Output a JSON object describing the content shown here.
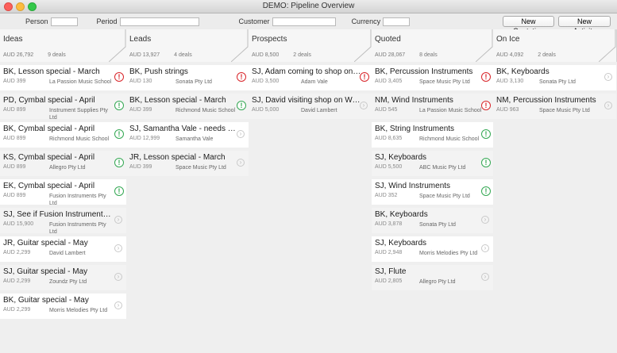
{
  "window": {
    "title": "DEMO: Pipeline Overview"
  },
  "toolbar": {
    "person_label": "Person",
    "person_value": "",
    "period_label": "Period",
    "period_value": "",
    "customer_label": "Customer",
    "customer_value": "",
    "currency_label": "Currency",
    "currency_value": "",
    "new_quotation": "New Quotation",
    "new_activity": "New Activity"
  },
  "columns": [
    {
      "title": "Ideas",
      "amount": "AUD 26,792",
      "deals": "9 deals",
      "cards": [
        {
          "title": "BK, Lesson special - March",
          "amount": "AUD 399",
          "customer": "La Passion Music School",
          "status": "red"
        },
        {
          "title": "PD, Cymbal special - April",
          "amount": "AUD 899",
          "customer": "Instrument Supplies Pty Ltd",
          "status": "green"
        },
        {
          "title": "BK, Cymbal special - April",
          "amount": "AUD 899",
          "customer": "Richmond Music School",
          "status": "green"
        },
        {
          "title": "KS, Cymbal special - April",
          "amount": "AUD 899",
          "customer": "Allegro Pty Ltd",
          "status": "green"
        },
        {
          "title": "EK, Cymbal special - April",
          "amount": "AUD 899",
          "customer": "Fusion Instruments Pty Ltd",
          "status": "green"
        },
        {
          "title": "SJ, See if Fusion Instruments wa...",
          "amount": "AUD 15,900",
          "customer": "Fusion Instruments Pty Ltd",
          "status": "arrow"
        },
        {
          "title": "JR, Guitar special - May",
          "amount": "AUD 2,299",
          "customer": "David Lambert",
          "status": "arrow"
        },
        {
          "title": "SJ, Guitar special - May",
          "amount": "AUD 2,299",
          "customer": "Zoundz Pty Ltd",
          "status": "arrow"
        },
        {
          "title": "BK, Guitar special - May",
          "amount": "AUD 2,299",
          "customer": "Morris Melodies Pty Ltd",
          "status": "arrow"
        }
      ]
    },
    {
      "title": "Leads",
      "amount": "AUD 13,927",
      "deals": "4 deals",
      "cards": [
        {
          "title": "BK, Push strings",
          "amount": "AUD 130",
          "customer": "Sonata Pty Ltd",
          "status": "red"
        },
        {
          "title": "BK, Lesson special - March",
          "amount": "AUD 399",
          "customer": "Richmond Music School",
          "status": "green"
        },
        {
          "title": "SJ, Samantha Vale - needs upgr...",
          "amount": "AUD 12,999",
          "customer": "Samantha Vale",
          "status": "arrow"
        },
        {
          "title": "JR, Lesson special - March",
          "amount": "AUD 399",
          "customer": "Space Music Pty Ltd",
          "status": "arrow"
        }
      ]
    },
    {
      "title": "Prospects",
      "amount": "AUD 8,500",
      "deals": "2 deals",
      "cards": [
        {
          "title": "SJ, Adam coming to shop on W...",
          "amount": "AUD 3,500",
          "customer": "Adam Vale",
          "status": "red"
        },
        {
          "title": "SJ, David visiting shop on Wedn...",
          "amount": "AUD 5,000",
          "customer": "David Lambert",
          "status": "arrow"
        }
      ]
    },
    {
      "title": "Quoted",
      "amount": "AUD 28,067",
      "deals": "8 deals",
      "cards": [
        {
          "title": "BK, Percussion Instruments",
          "amount": "AUD 3,405",
          "customer": "Space Music Pty Ltd",
          "status": "red"
        },
        {
          "title": "NM, Wind Instruments",
          "amount": "AUD 545",
          "customer": "La Passion Music School",
          "status": "red"
        },
        {
          "title": "BK, String Instruments",
          "amount": "AUD 8,635",
          "customer": "Richmond Music School",
          "status": "green"
        },
        {
          "title": "SJ, Keyboards",
          "amount": "AUD 5,500",
          "customer": "ABC Music Pty Ltd",
          "status": "green"
        },
        {
          "title": "SJ, Wind Instruments",
          "amount": "AUD 352",
          "customer": "Space Music Pty Ltd",
          "status": "green"
        },
        {
          "title": "BK, Keyboards",
          "amount": "AUD 3,878",
          "customer": "Sonata Pty Ltd",
          "status": "arrow"
        },
        {
          "title": "SJ, Keyboards",
          "amount": "AUD 2,948",
          "customer": "Morris Melodies Pty Ltd",
          "status": "arrow"
        },
        {
          "title": "SJ, Flute",
          "amount": "AUD 2,805",
          "customer": "Allegro Pty Ltd",
          "status": "arrow"
        }
      ]
    },
    {
      "title": "On Ice",
      "amount": "AUD 4,092",
      "deals": "2 deals",
      "cards": [
        {
          "title": "BK, Keyboards",
          "amount": "AUD 3,130",
          "customer": "Sonata Pty Ltd",
          "status": "arrow"
        },
        {
          "title": "NM, Percussion Instruments",
          "amount": "AUD 963",
          "customer": "Space Music Pty Ltd",
          "status": "arrow"
        }
      ]
    }
  ],
  "icons": {
    "red": "exclamation-icon",
    "green": "exclamation-icon",
    "arrow": "chevron-right-icon"
  },
  "colors": {
    "red": "#d9262b",
    "green": "#34a853"
  }
}
